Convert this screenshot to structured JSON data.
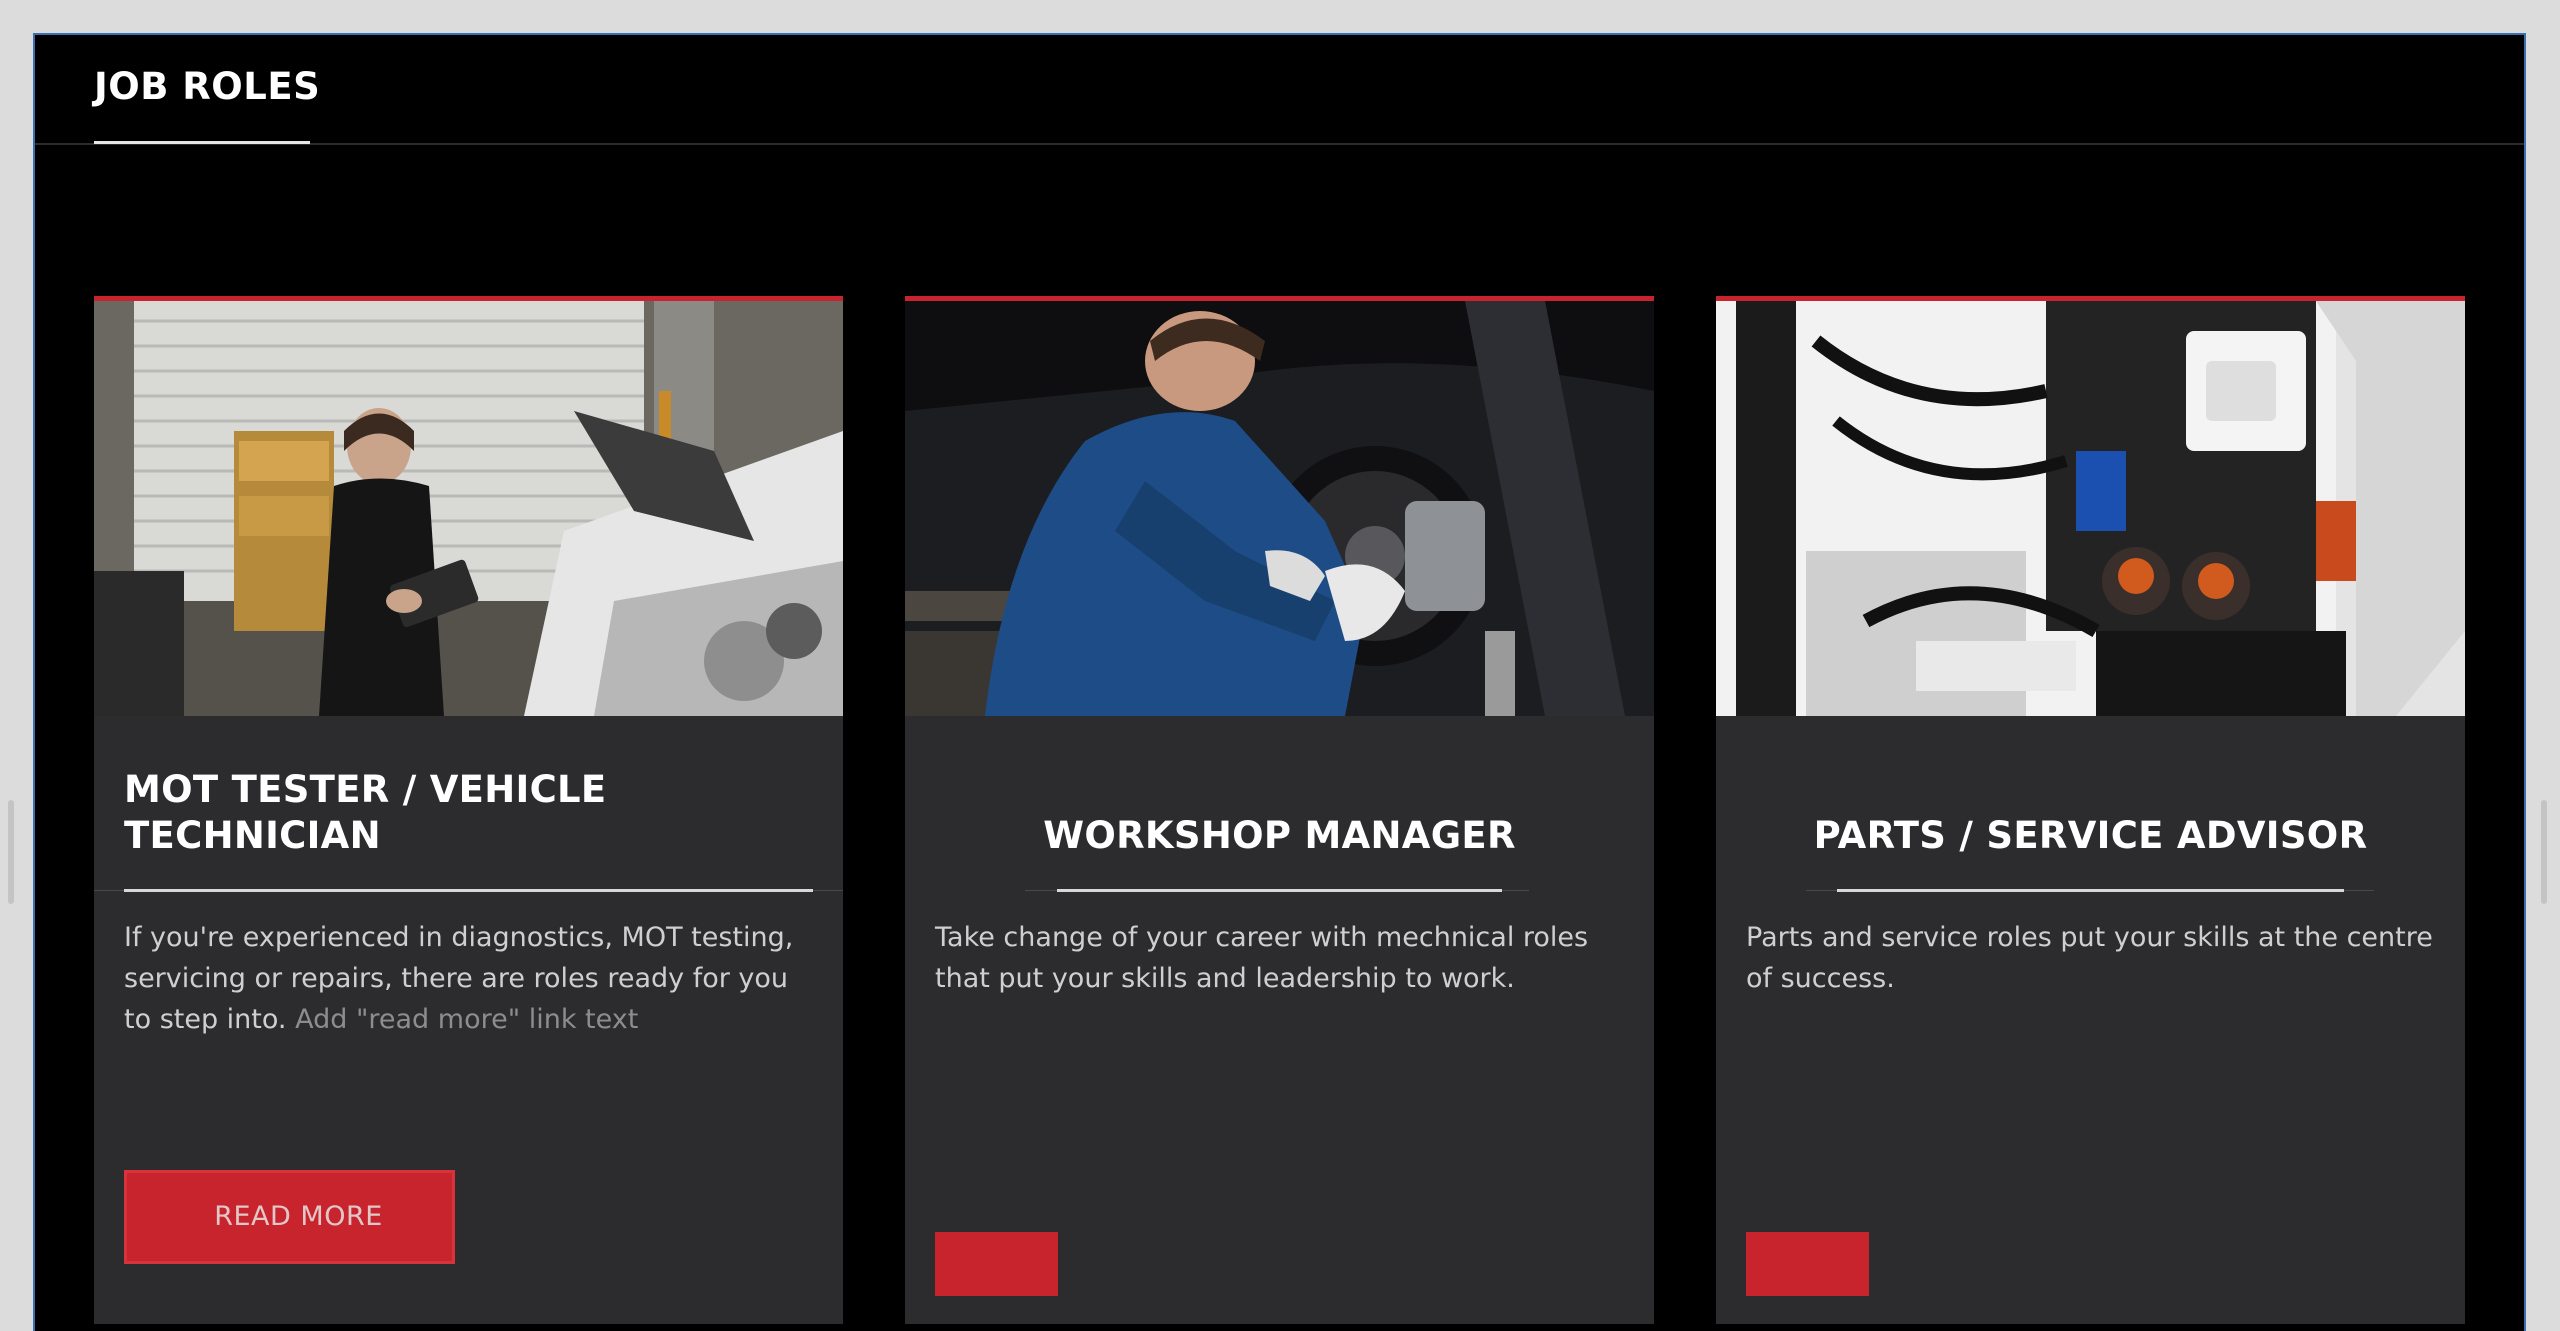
{
  "page": {
    "section_title": "JOB ROLES"
  },
  "cards": [
    {
      "title": "MOT TESTER / VEHICLE TECHNICIAN",
      "description": "If you're experienced in diagnostics, MOT testing, servicing or repairs, there are roles ready for you to step into.",
      "link_text": "Add \"read more\" link text",
      "button_label": "READ MORE",
      "image": "technician-with-tablet-photo"
    },
    {
      "title": "WORKSHOP MANAGER",
      "description": "Take change of your career with mechnical roles that put your skills and leadership to work.",
      "button_label": "",
      "image": "mechanic-brake-disc-photo"
    },
    {
      "title": "PARTS / SERVICE ADVISOR",
      "description": "Parts and service roles put your skills at the centre of success.",
      "button_label": "",
      "image": "engine-bay-photo"
    }
  ],
  "colors": {
    "accent": "#c8242d",
    "card_bg": "#2c2b2e",
    "panel_bg": "#000000",
    "selection_border": "#3a6fb0"
  }
}
